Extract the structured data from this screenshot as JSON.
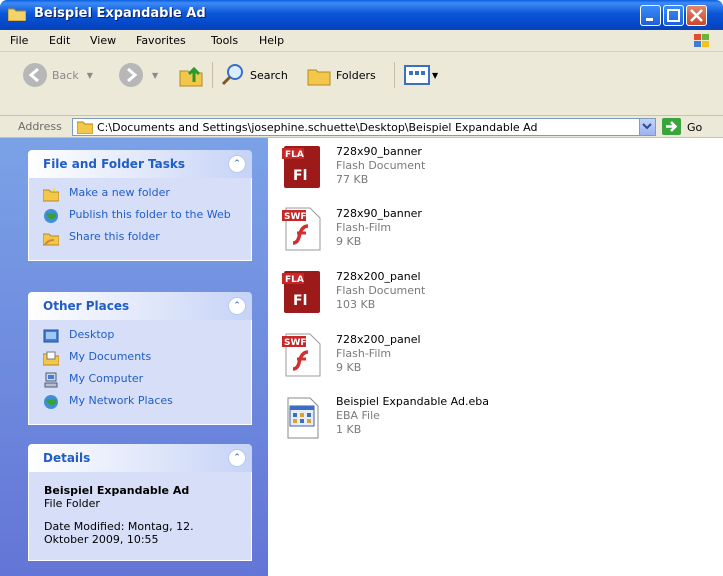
{
  "window": {
    "title": "Beispiel Expandable Ad"
  },
  "menu": {
    "items": [
      "File",
      "Edit",
      "View",
      "Favorites",
      "Tools",
      "Help"
    ]
  },
  "toolbar": {
    "back": "Back",
    "search": "Search",
    "folders": "Folders"
  },
  "address": {
    "label": "Address",
    "path": "C:\\Documents and Settings\\josephine.schuette\\Desktop\\Beispiel Expandable Ad",
    "go": "Go"
  },
  "tasks_panel": {
    "title": "File and Folder Tasks",
    "items": [
      {
        "label": "Make a new folder",
        "icon": "new-folder-icon"
      },
      {
        "label": "Publish this folder to the Web",
        "icon": "publish-web-icon"
      },
      {
        "label": "Share this folder",
        "icon": "share-folder-icon"
      }
    ]
  },
  "places_panel": {
    "title": "Other Places",
    "items": [
      {
        "label": "Desktop",
        "icon": "desktop-icon"
      },
      {
        "label": "My Documents",
        "icon": "my-documents-icon"
      },
      {
        "label": "My Computer",
        "icon": "my-computer-icon"
      },
      {
        "label": "My Network Places",
        "icon": "network-places-icon"
      }
    ]
  },
  "details_panel": {
    "title": "Details",
    "name": "Beispiel Expandable Ad",
    "type": "File Folder",
    "modified": "Date Modified: Montag, 12. Oktober 2009, 10:55"
  },
  "files": [
    {
      "name": "728x90_banner",
      "type": "Flash Document",
      "size": "77 KB",
      "icon": "fla-file-icon"
    },
    {
      "name": "728x90_banner",
      "type": "Flash-Film",
      "size": "9 KB",
      "icon": "swf-file-icon"
    },
    {
      "name": "728x200_panel",
      "type": "Flash Document",
      "size": "103 KB",
      "icon": "fla-file-icon"
    },
    {
      "name": "728x200_panel",
      "type": "Flash-Film",
      "size": "9 KB",
      "icon": "swf-file-icon"
    },
    {
      "name": "Beispiel Expandable Ad.eba",
      "type": "EBA File",
      "size": "1 KB",
      "icon": "eba-file-icon"
    }
  ]
}
